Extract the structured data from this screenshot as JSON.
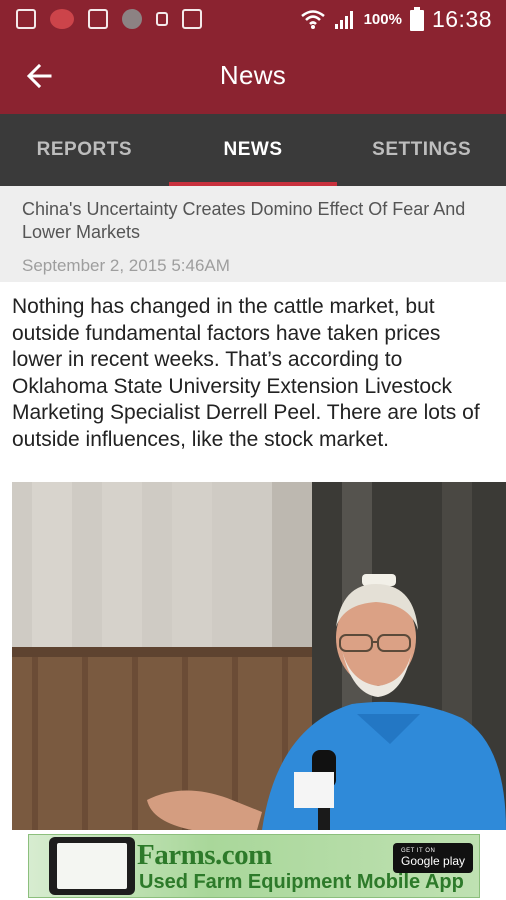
{
  "status_bar": {
    "battery": "100%",
    "time": "16:38"
  },
  "app_bar": {
    "title": "News"
  },
  "tabs": [
    {
      "label": "REPORTS"
    },
    {
      "label": "NEWS"
    },
    {
      "label": "SETTINGS"
    }
  ],
  "active_tab": "NEWS",
  "article": {
    "title": "China's Uncertainty Creates Domino Effect Of Fear And Lower Markets",
    "date": "September 2, 2015 5:46AM",
    "body": "Nothing has changed in the cattle market, but outside fundamental factors have taken prices lower in recent weeks. That’s according to Oklahoma State University Extension Livestock Marketing Specialist Derrell Peel. There are lots of outside influences, like the stock market."
  },
  "ad": {
    "brand": "Farms.com",
    "tagline": "Used Farm Equipment Mobile App",
    "store_small": "GET IT ON",
    "store_big": "Google play"
  },
  "colors": {
    "app_bar": "#8b2330",
    "tab_bar": "#3a3a3a",
    "tab_indicator": "#c8313d",
    "header_bg": "#eeeeee"
  },
  "icons": {
    "back": "arrow-left-icon",
    "wifi": "wifi-icon",
    "signal": "signal-icon",
    "battery": "battery-icon"
  }
}
